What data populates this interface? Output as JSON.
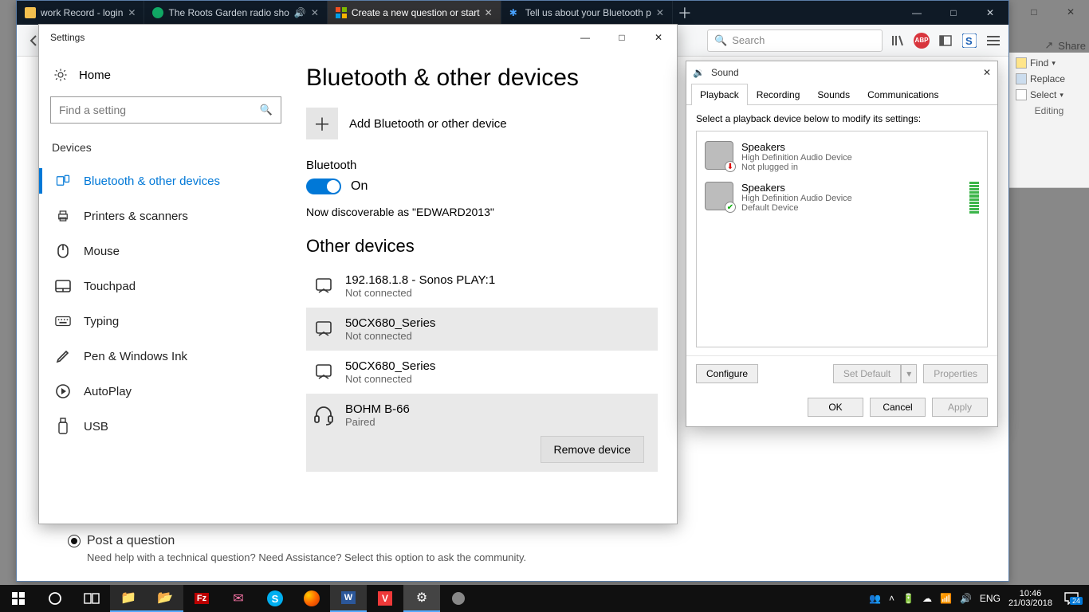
{
  "browser": {
    "tabs": [
      {
        "label": "work Record - login"
      },
      {
        "label": "The Roots Garden radio sho"
      },
      {
        "label": "Create a new question or start"
      },
      {
        "label": "Tell us about your Bluetooth p"
      }
    ],
    "search_placeholder": "Search"
  },
  "ribbon": {
    "find": "Find",
    "replace": "Replace",
    "select": "Select",
    "editing": "Editing",
    "share": "Share"
  },
  "settings": {
    "title": "Settings",
    "home": "Home",
    "search_placeholder": "Find a setting",
    "section": "Devices",
    "nav": [
      "Bluetooth & other devices",
      "Printers & scanners",
      "Mouse",
      "Touchpad",
      "Typing",
      "Pen & Windows Ink",
      "AutoPlay",
      "USB"
    ],
    "main": {
      "heading": "Bluetooth & other devices",
      "add_label": "Add Bluetooth or other device",
      "bt_label": "Bluetooth",
      "bt_state": "On",
      "discoverable": "Now discoverable as \"EDWARD2013\"",
      "other_heading": "Other devices",
      "devices": [
        {
          "name": "192.168.1.8 - Sonos PLAY:1",
          "status": "Not connected"
        },
        {
          "name": "50CX680_Series",
          "status": "Not connected"
        },
        {
          "name": "50CX680_Series",
          "status": "Not connected"
        },
        {
          "name": "BOHM B-66",
          "status": "Paired"
        }
      ],
      "remove": "Remove device"
    }
  },
  "sound": {
    "title": "Sound",
    "tabs": [
      "Playback",
      "Recording",
      "Sounds",
      "Communications"
    ],
    "prompt": "Select a playback device below to modify its settings:",
    "devices": [
      {
        "name": "Speakers",
        "desc": "High Definition Audio Device",
        "status": "Not plugged in",
        "overlay": "err"
      },
      {
        "name": "Speakers",
        "desc": "High Definition Audio Device",
        "status": "Default Device",
        "overlay": "ok"
      }
    ],
    "configure": "Configure",
    "setdefault": "Set Default",
    "properties": "Properties",
    "ok": "OK",
    "cancel": "Cancel",
    "apply": "Apply"
  },
  "question": {
    "label": "Post a question",
    "help": "Need help with a technical question? Need Assistance? Select this option to ask the community."
  },
  "tray": {
    "lang": "ENG",
    "time": "10:46",
    "date": "21/03/2018",
    "count": "24"
  }
}
